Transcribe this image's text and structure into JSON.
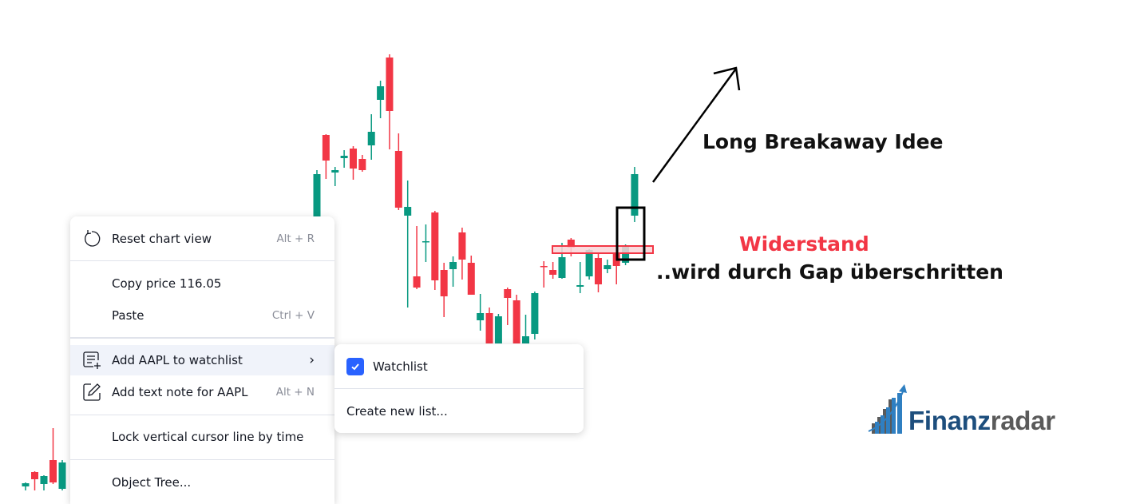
{
  "chart_data": {
    "type": "candlestick",
    "title": "",
    "symbol": "AAPL",
    "price_scale": {
      "visible": false
    },
    "colors": {
      "up": "#089981",
      "down": "#f23645",
      "resistance_fill": "#f9d4d7",
      "resistance_border": "#f23645",
      "box": "#000000",
      "arrow": "#000000"
    },
    "candles_left_cluster": [
      {
        "o": 85.1,
        "h": 85.6,
        "l": 84.6,
        "c": 85.5,
        "dir": "up"
      },
      {
        "o": 86.9,
        "h": 87.0,
        "l": 84.6,
        "c": 86.0,
        "dir": "down"
      },
      {
        "o": 85.4,
        "h": 86.5,
        "l": 84.6,
        "c": 86.4,
        "dir": "up"
      },
      {
        "o": 88.4,
        "h": 92.4,
        "l": 85.4,
        "c": 85.6,
        "dir": "down"
      },
      {
        "o": 84.8,
        "h": 88.4,
        "l": 84.6,
        "c": 88.1,
        "dir": "up"
      }
    ],
    "candles": [
      {
        "o": 118.0,
        "h": 124.7,
        "l": 117.0,
        "c": 124.2,
        "dir": "up"
      },
      {
        "o": 129.1,
        "h": 129.2,
        "l": 123.6,
        "c": 125.9,
        "dir": "down"
      },
      {
        "o": 124.4,
        "h": 125.1,
        "l": 122.7,
        "c": 124.7,
        "dir": "up"
      },
      {
        "o": 126.2,
        "h": 127.2,
        "l": 125.0,
        "c": 126.5,
        "dir": "up"
      },
      {
        "o": 127.4,
        "h": 127.7,
        "l": 123.5,
        "c": 124.9,
        "dir": "down"
      },
      {
        "o": 126.1,
        "h": 126.6,
        "l": 124.5,
        "c": 124.7,
        "dir": "down"
      },
      {
        "o": 127.8,
        "h": 131.7,
        "l": 126.0,
        "c": 129.5,
        "dir": "up"
      },
      {
        "o": 133.5,
        "h": 135.9,
        "l": 131.2,
        "c": 135.2,
        "dir": "up"
      },
      {
        "o": 138.8,
        "h": 139.2,
        "l": 127.3,
        "c": 132.1,
        "dir": "down"
      },
      {
        "o": 127.1,
        "h": 129.3,
        "l": 119.7,
        "c": 120.0,
        "dir": "down"
      },
      {
        "o": 119.0,
        "h": 123.4,
        "l": 107.5,
        "c": 120.1,
        "dir": "up"
      },
      {
        "o": 111.4,
        "h": 117.7,
        "l": 109.8,
        "c": 110.0,
        "dir": "down"
      },
      {
        "o": 115.7,
        "h": 117.9,
        "l": 113.2,
        "c": 115.8,
        "dir": "up"
      },
      {
        "o": 119.4,
        "h": 119.6,
        "l": 109.7,
        "c": 110.9,
        "dir": "down"
      },
      {
        "o": 112.2,
        "h": 113.1,
        "l": 106.3,
        "c": 108.9,
        "dir": "down"
      },
      {
        "o": 112.3,
        "h": 113.9,
        "l": 110.1,
        "c": 113.2,
        "dir": "up"
      },
      {
        "o": 116.9,
        "h": 117.5,
        "l": 111.0,
        "c": 113.5,
        "dir": "down"
      },
      {
        "o": 113.1,
        "h": 114.0,
        "l": 109.1,
        "c": 109.1,
        "dir": "down"
      },
      {
        "o": 105.9,
        "h": 109.2,
        "l": 104.6,
        "c": 106.8,
        "dir": "up"
      },
      {
        "o": 106.8,
        "h": 107.5,
        "l": 103.0,
        "c": 103.0,
        "dir": "down"
      },
      {
        "o": 103.0,
        "h": 106.7,
        "l": 103.0,
        "c": 106.4,
        "dir": "up"
      },
      {
        "o": 109.8,
        "h": 110.0,
        "l": 105.3,
        "c": 108.7,
        "dir": "down"
      },
      {
        "o": 108.4,
        "h": 109.1,
        "l": 103.0,
        "c": 103.0,
        "dir": "down"
      },
      {
        "o": 103.0,
        "h": 106.6,
        "l": 103.0,
        "c": 103.9,
        "dir": "up"
      },
      {
        "o": 104.2,
        "h": 109.5,
        "l": 103.5,
        "c": 109.3,
        "dir": "up"
      },
      {
        "o": 112.7,
        "h": 113.3,
        "l": 110.0,
        "c": 112.6,
        "dir": "down"
      },
      {
        "o": 112.2,
        "h": 113.2,
        "l": 111.1,
        "c": 111.6,
        "dir": "down"
      },
      {
        "o": 111.2,
        "h": 115.6,
        "l": 111.1,
        "c": 113.8,
        "dir": "up"
      },
      {
        "o": 116.0,
        "h": 116.2,
        "l": 113.9,
        "c": 115.0,
        "dir": "down"
      },
      {
        "o": 110.1,
        "h": 113.2,
        "l": 109.3,
        "c": 110.3,
        "dir": "up"
      },
      {
        "o": 111.4,
        "h": 114.8,
        "l": 111.0,
        "c": 114.7,
        "dir": "up"
      },
      {
        "o": 113.7,
        "h": 114.2,
        "l": 109.4,
        "c": 110.4,
        "dir": "down"
      },
      {
        "o": 112.3,
        "h": 113.5,
        "l": 111.8,
        "c": 112.8,
        "dir": "up"
      },
      {
        "o": 114.3,
        "h": 114.3,
        "l": 110.4,
        "c": 112.7,
        "dir": "down"
      },
      {
        "o": 113.1,
        "h": 115.4,
        "l": 112.8,
        "c": 115.2,
        "dir": "up"
      },
      {
        "o": 119.0,
        "h": 125.1,
        "l": 118.2,
        "c": 124.2,
        "dir": "up"
      }
    ],
    "annotations": [
      {
        "type": "resistance-zone",
        "from_price": 115.2,
        "to_price": 114.3
      },
      {
        "type": "gap-box",
        "top_price": 120.0,
        "bottom_price": 113.5
      },
      {
        "type": "arrow",
        "direction": "up-right"
      }
    ],
    "labels": {
      "idea": "Long Breakaway Idee",
      "resistance": "Widerstand",
      "gap_note": "..wird durch Gap überschritten"
    }
  },
  "context_menu": {
    "items": [
      {
        "icon": "reset-icon",
        "label": "Reset chart view",
        "shortcut": "Alt + R"
      },
      {
        "label": "Copy price 116.05"
      },
      {
        "label": "Paste",
        "shortcut": "Ctrl + V"
      },
      {
        "icon": "add-list-icon",
        "label": "Add AAPL to watchlist",
        "submenu": true
      },
      {
        "icon": "pencil-note-icon",
        "label": "Add text note for AAPL",
        "shortcut": "Alt + N"
      },
      {
        "label": "Lock vertical cursor line by time"
      },
      {
        "label": "Object Tree..."
      }
    ]
  },
  "submenu": {
    "items": [
      {
        "label": "Watchlist",
        "checked": true
      },
      {
        "label": "Create new list..."
      }
    ]
  },
  "logo": {
    "part1": "Finanz",
    "part2": "radar"
  }
}
